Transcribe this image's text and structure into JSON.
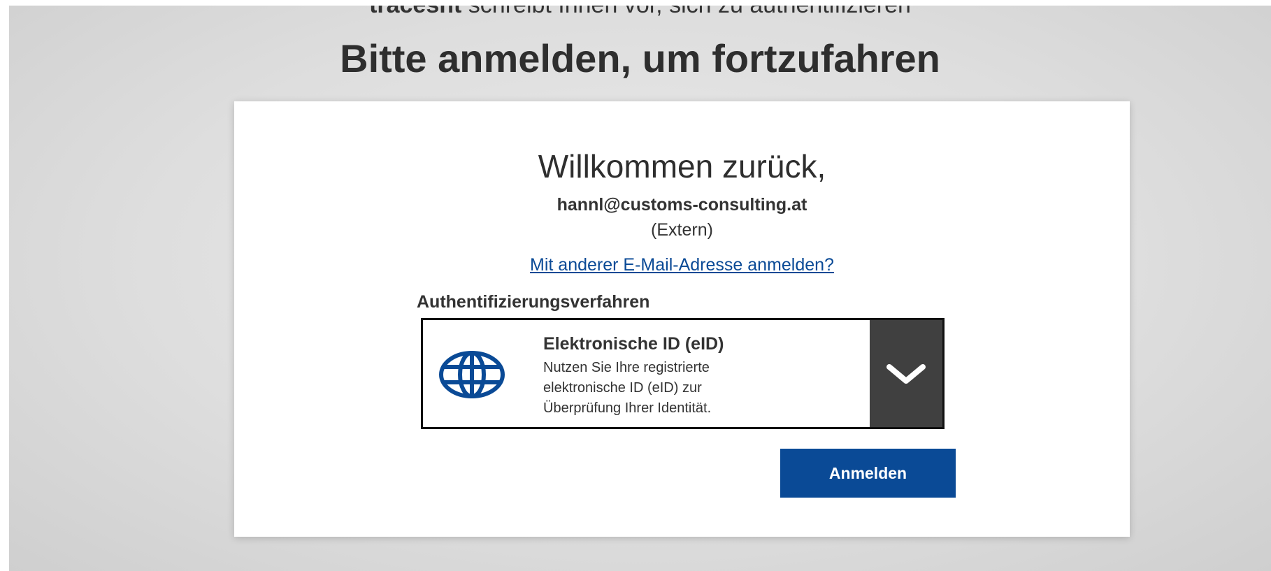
{
  "header": {
    "app_name": "tracesnt",
    "auth_notice": "schreibt Ihnen vor, sich zu authentifizieren",
    "title": "Bitte anmelden, um fortzufahren"
  },
  "card": {
    "welcome": "Willkommen zurück,",
    "email": "hannl@customs-consulting.at",
    "account_type": "(Extern)",
    "switch_link": "Mit anderer E-Mail-Adresse anmelden?",
    "auth_label": "Authentifizierungsverfahren",
    "method": {
      "icon": "globe-icon",
      "title": "Elektronische ID (eID)",
      "desc_lines": [
        "Nutzen Sie Ihre registrierte",
        "elektronische ID (eID) zur",
        "Überprüfung Ihrer Identität."
      ]
    },
    "submit_label": "Anmelden"
  },
  "colors": {
    "primary": "#0a4a96",
    "dropdown_toggle": "#404040",
    "text": "#333333"
  }
}
